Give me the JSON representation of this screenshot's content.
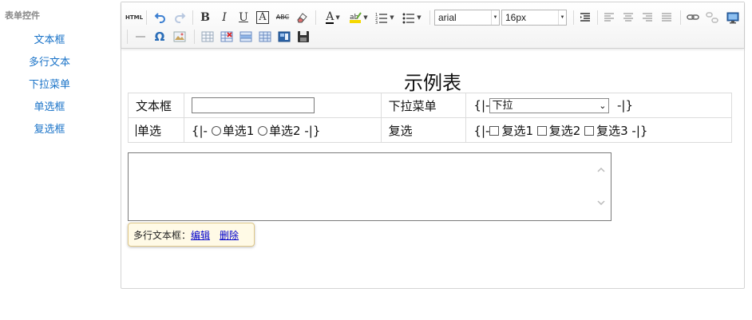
{
  "sidebar": {
    "title": "表单控件",
    "items": [
      {
        "label": "文本框"
      },
      {
        "label": "多行文本"
      },
      {
        "label": "下拉菜单"
      },
      {
        "label": "单选框"
      },
      {
        "label": "复选框"
      }
    ]
  },
  "toolbar": {
    "source_label": "HTML",
    "bold_label": "B",
    "italic_label": "I",
    "underline_label": "U",
    "font_color_label": "A",
    "strike_label": "ABC",
    "font_family": "arial",
    "font_size": "16px",
    "omega_label": "Ω"
  },
  "document": {
    "title": "示例表",
    "rows": [
      {
        "c1": "文本框",
        "c3": "下拉菜单",
        "c4_prefix": "{|-",
        "c4_select": "下拉",
        "c4_suffix": "-|}"
      },
      {
        "c1": "单选",
        "c2_prefix": "{|-",
        "radio1": "单选1",
        "radio2": "单选2",
        "c2_suffix": "-|}",
        "c3": "复选",
        "c4_prefix": "{|-",
        "check1": "复选1",
        "check2": "复选2",
        "check3": "复选3",
        "c4_suffix": "-|}"
      }
    ]
  },
  "popup": {
    "label": "多行文本框：",
    "edit": "编辑",
    "delete": "删除"
  },
  "colors": {
    "sidebar_link": "#1a73c8",
    "undo_blue": "#3c7fd1",
    "popup_bg": "#fffae6"
  }
}
